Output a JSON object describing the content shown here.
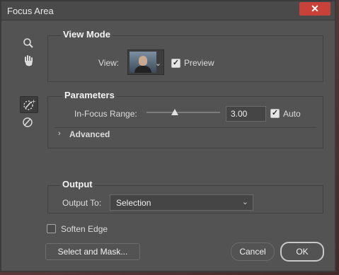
{
  "window": {
    "title": "Focus Area",
    "close_glyph": "✕"
  },
  "tools": [
    "zoom-icon",
    "hand-icon",
    "focus-area-add-icon",
    "focus-area-subtract-icon"
  ],
  "view_mode": {
    "heading": "View Mode",
    "view_label": "View:",
    "preview_label": "Preview",
    "preview_checked": true
  },
  "parameters": {
    "heading": "Parameters",
    "range_label": "In-Focus Range:",
    "range_value": "3.00",
    "range_fraction": 0.38,
    "auto_label": "Auto",
    "auto_checked": true,
    "advanced_label": "Advanced"
  },
  "output": {
    "heading": "Output",
    "output_to_label": "Output To:",
    "output_to_value": "Selection"
  },
  "soften_edge": {
    "label": "Soften Edge",
    "checked": false
  },
  "buttons": {
    "select_mask": "Select and Mask...",
    "cancel": "Cancel",
    "ok": "OK"
  },
  "colors": {
    "close": "#c8423a",
    "panel": "#535353"
  }
}
